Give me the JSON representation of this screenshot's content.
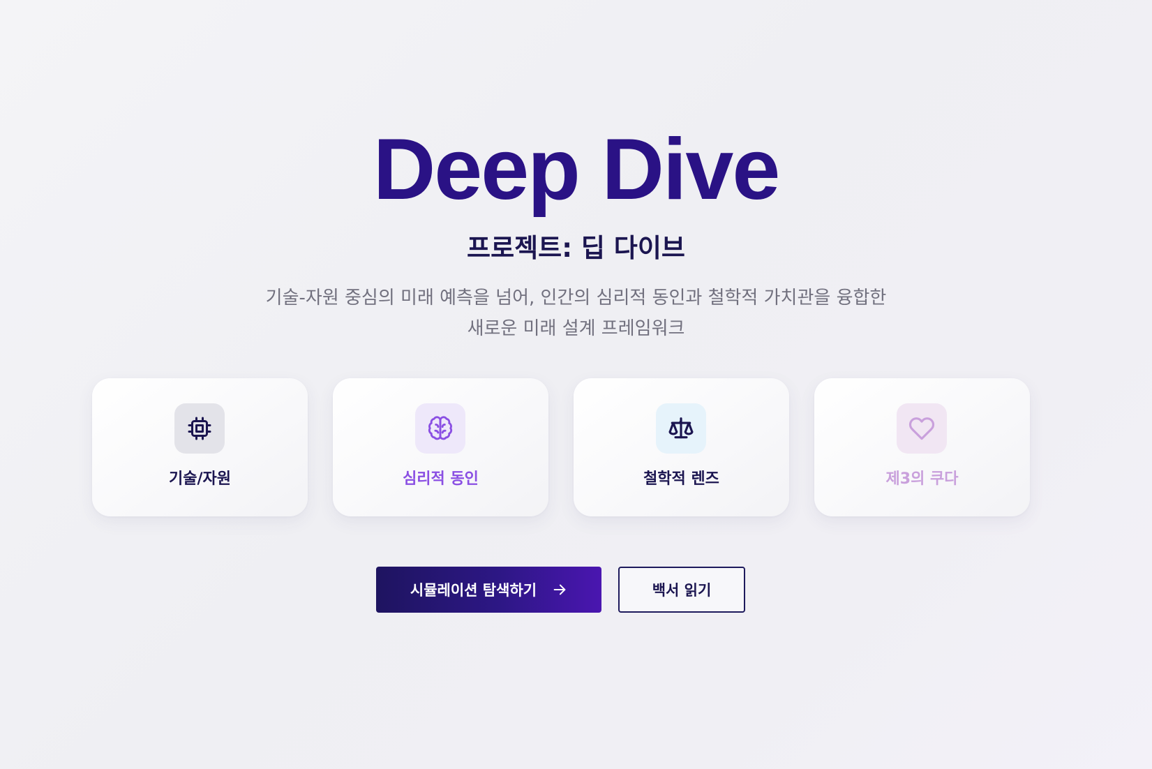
{
  "hero": {
    "title": "Deep Dive",
    "subtitle": "프로젝트: 딥 다이브",
    "description_line1": "기술-자원 중심의 미래 예측을 넘어, 인간의 심리적 동인과 철학적 가치관을 융합한",
    "description_line2": "새로운 미래 설계 프레임워크"
  },
  "cards": [
    {
      "label": "기술/자원",
      "icon": "chip-icon",
      "color": "#1b1550",
      "icon_bg": "#e3e3e9"
    },
    {
      "label": "심리적 동인",
      "icon": "brain-icon",
      "color": "#8a4fe3",
      "icon_bg": "#eee8fa"
    },
    {
      "label": "철학적 렌즈",
      "icon": "scale-icon",
      "color": "#1b1550",
      "icon_bg": "#e6f3fb"
    },
    {
      "label": "제3의 쿠다",
      "icon": "heart-icon",
      "color": "#c9a0dc",
      "icon_bg": "#f1e6f3"
    }
  ],
  "actions": {
    "primary_label": "시뮬레이션 탐색하기",
    "primary_icon": "arrow-right-icon",
    "secondary_label": "백서 읽기"
  },
  "colors": {
    "title": "#2a1285",
    "subtitle": "#1b1550",
    "description": "#71707e",
    "primary_button_start": "#1e1460",
    "primary_button_end": "#4a16b0"
  }
}
